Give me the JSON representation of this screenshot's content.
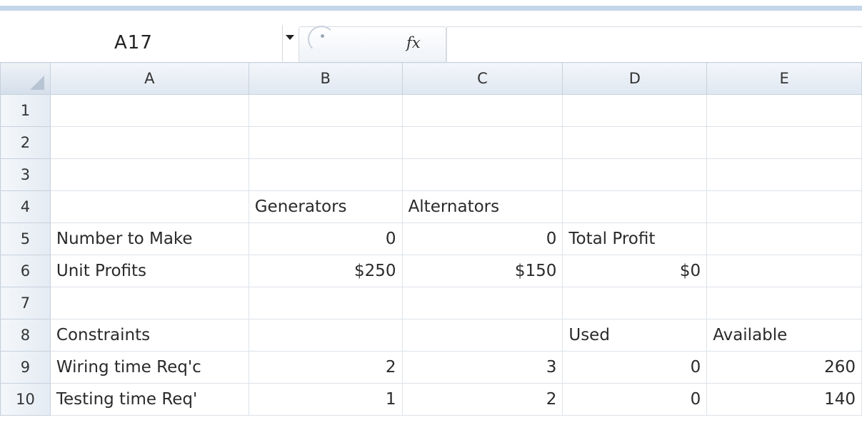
{
  "formula_bar": {
    "name_box": "A17",
    "fx_label": "fx",
    "formula": ""
  },
  "columns": [
    "A",
    "B",
    "C",
    "D",
    "E"
  ],
  "rows": [
    {
      "row": "1",
      "cells": [
        "",
        "",
        "",
        "",
        ""
      ]
    },
    {
      "row": "2",
      "cells": [
        "",
        "",
        "",
        "",
        ""
      ]
    },
    {
      "row": "3",
      "cells": [
        "",
        "",
        "",
        "",
        ""
      ]
    },
    {
      "row": "4",
      "cells": [
        "",
        "Generators",
        "Alternators",
        "",
        ""
      ]
    },
    {
      "row": "5",
      "cells": [
        "Number to Make",
        "0",
        "0",
        "Total Profit",
        ""
      ]
    },
    {
      "row": "6",
      "cells": [
        "Unit Profits",
        "$250",
        "$150",
        "$0",
        ""
      ]
    },
    {
      "row": "7",
      "cells": [
        "",
        "",
        "",
        "",
        ""
      ]
    },
    {
      "row": "8",
      "cells": [
        "Constraints",
        "",
        "",
        "Used",
        "Available"
      ]
    },
    {
      "row": "9",
      "cells": [
        "Wiring time Req'c",
        "2",
        "3",
        "0",
        "260"
      ]
    },
    {
      "row": "10",
      "cells": [
        "Testing time Req'",
        "1",
        "2",
        "0",
        "140"
      ]
    }
  ],
  "colors": {
    "header_bg": "#dfe7f1",
    "grid_line": "#dde3ea",
    "accent_band": "#c4d6ea"
  }
}
